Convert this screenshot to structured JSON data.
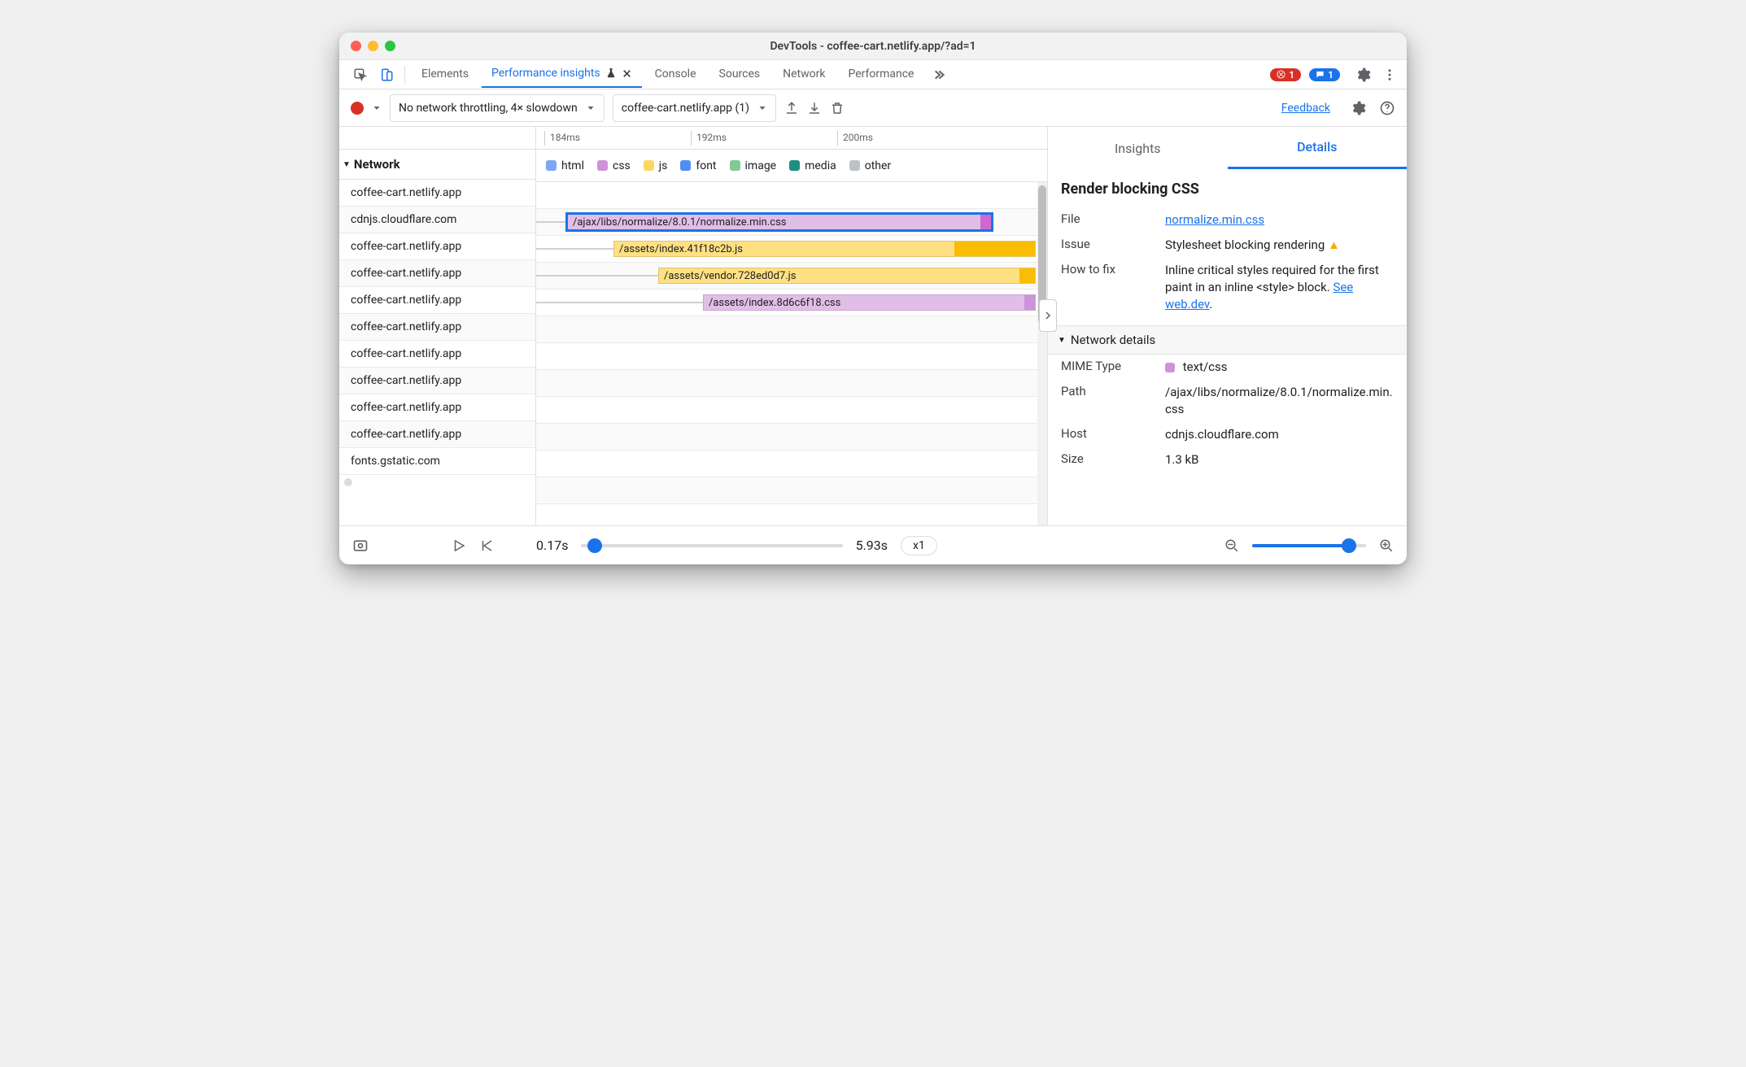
{
  "window": {
    "title": "DevTools - coffee-cart.netlify.app/?ad=1"
  },
  "tabs": {
    "elements": "Elements",
    "perfInsights": "Performance insights",
    "console": "Console",
    "sources": "Sources",
    "network": "Network",
    "performance": "Performance"
  },
  "alerts": {
    "errors": "1",
    "messages": "1"
  },
  "toolbar": {
    "throttling": "No network throttling, 4× slowdown",
    "target": "coffee-cart.netlify.app (1)",
    "feedback": "Feedback"
  },
  "ruler": {
    "t1": "184ms",
    "t2": "192ms",
    "t3": "200ms"
  },
  "legend": {
    "html": "html",
    "css": "css",
    "js": "js",
    "font": "font",
    "image": "image",
    "media": "media",
    "other": "other"
  },
  "legendColors": {
    "html": "#7aa8f7",
    "css": "#ce93d8",
    "js": "#fdd663",
    "font": "#4f8ff7",
    "image": "#81c995",
    "media": "#1e8e7e",
    "other": "#bdc1c6"
  },
  "networkHeader": "Network",
  "hosts": [
    "coffee-cart.netlify.app",
    "cdnjs.cloudflare.com",
    "coffee-cart.netlify.app",
    "coffee-cart.netlify.app",
    "coffee-cart.netlify.app",
    "coffee-cart.netlify.app",
    "coffee-cart.netlify.app",
    "coffee-cart.netlify.app",
    "coffee-cart.netlify.app",
    "coffee-cart.netlify.app",
    "fonts.gstatic.com"
  ],
  "bars": {
    "b1": "/ajax/libs/normalize/8.0.1/normalize.min.css",
    "b2": "/assets/index.41f18c2b.js",
    "b3": "/assets/vendor.728ed0d7.js",
    "b4": "/assets/index.8d6c6f18.css"
  },
  "dpanel": {
    "tabInsights": "Insights",
    "tabDetails": "Details",
    "heading": "Render blocking CSS",
    "rows": {
      "fileK": "File",
      "fileV": "normalize.min.css",
      "issueK": "Issue",
      "issueV": "Stylesheet blocking rendering",
      "fixK": "How to fix",
      "fixV": "Inline critical styles required for the first paint in an inline <style> block. ",
      "fixLink": "See web.dev",
      "fixSuffix": "."
    },
    "section": "Network details",
    "net": {
      "mimeK": "MIME Type",
      "mimeV": "text/css",
      "pathK": "Path",
      "pathV": "/ajax/libs/normalize/8.0.1/normalize.min.css",
      "hostK": "Host",
      "hostV": "cdnjs.cloudflare.com",
      "sizeK": "Size",
      "sizeV": "1.3 kB"
    }
  },
  "footer": {
    "start": "0.17s",
    "end": "5.93s",
    "speed": "x1"
  }
}
